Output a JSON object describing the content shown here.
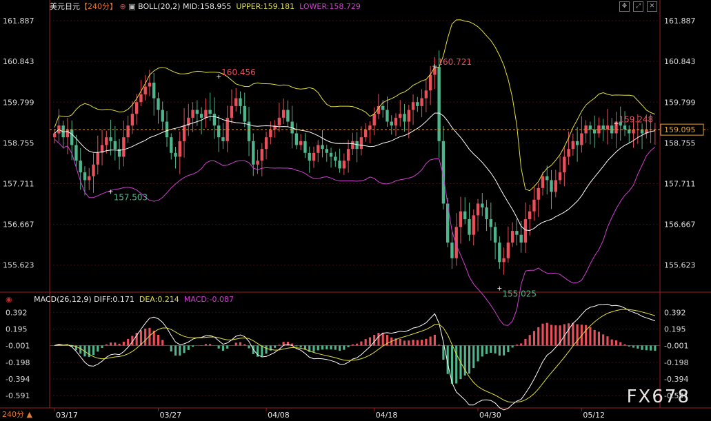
{
  "header": {
    "symbol": "美元日元",
    "period": "【240分】",
    "indicator": "BOLL(20,2)",
    "mid": "MID:158.955",
    "upper": "UPPER:159.181",
    "lower": "LOWER:158.729"
  },
  "macd_header": {
    "indicator": "MACD(26,12,9)",
    "diff": "DIFF:0.171",
    "dea": "DEA:0.214",
    "macd": "MACD:-0.087"
  },
  "footer": {
    "period_button": "240分"
  },
  "watermark": "FX678",
  "colors": {
    "up": "#e8505b",
    "down": "#4fb58c",
    "mid": "#ffffff",
    "upper": "#e3e13c",
    "lower": "#d03fd0",
    "axis": "#9e2020",
    "current": "#e6a93a"
  },
  "chart_data": [
    {
      "type": "line",
      "name": "price",
      "y_ticks": [
        "161.887",
        "160.843",
        "159.799",
        "158.755",
        "157.711",
        "156.667",
        "155.623"
      ],
      "y_range": [
        155.0,
        162.1
      ],
      "x_ticks": [
        "03/17",
        "03/27",
        "04/08",
        "04/18",
        "04/30",
        "05/12"
      ],
      "bars_count": 140,
      "close": [
        159.0,
        159.2,
        158.9,
        159.1,
        158.7,
        158.3,
        158.0,
        157.8,
        157.9,
        158.2,
        158.5,
        158.7,
        158.9,
        158.8,
        158.6,
        158.4,
        158.9,
        159.2,
        159.5,
        159.8,
        160.0,
        160.2,
        160.3,
        159.9,
        159.6,
        159.3,
        158.9,
        158.5,
        158.4,
        158.8,
        159.2,
        159.4,
        159.6,
        159.5,
        159.4,
        159.6,
        159.5,
        159.2,
        158.9,
        158.8,
        159.4,
        159.7,
        159.9,
        159.7,
        159.3,
        158.8,
        158.2,
        158.3,
        158.6,
        158.9,
        159.1,
        159.2,
        159.4,
        159.6,
        159.3,
        159.0,
        158.7,
        158.8,
        158.5,
        158.3,
        158.5,
        158.7,
        158.6,
        158.5,
        158.4,
        158.3,
        158.1,
        158.3,
        158.6,
        158.8,
        158.6,
        158.9,
        159.1,
        159.2,
        159.5,
        159.7,
        159.6,
        159.3,
        159.2,
        159.4,
        159.5,
        159.3,
        159.6,
        159.8,
        159.7,
        159.9,
        160.1,
        160.5,
        160.7,
        158.8,
        157.2,
        156.2,
        155.8,
        156.6,
        157.0,
        156.8,
        156.4,
        156.9,
        157.2,
        157.1,
        156.8,
        156.6,
        156.2,
        155.7,
        155.8,
        156.2,
        156.5,
        156.4,
        156.2,
        156.8,
        157.0,
        157.3,
        157.6,
        157.9,
        157.8,
        157.5,
        157.8,
        158.0,
        158.4,
        158.6,
        158.8,
        158.7,
        159.0,
        159.2,
        159.1,
        159.0,
        159.2,
        159.1,
        159.2,
        159.0,
        159.3,
        159.2,
        159.1,
        159.0,
        159.1,
        159.1,
        159.0,
        159.1,
        159.1,
        159.1
      ],
      "series": [
        {
          "name": "MID",
          "value": 158.955
        },
        {
          "name": "UPPER",
          "value": 159.181
        },
        {
          "name": "LOWER",
          "value": 158.729
        }
      ],
      "current_price": "159.095",
      "annotations": [
        {
          "label": "160.456",
          "index": 38,
          "kind": "high"
        },
        {
          "label": "157.503",
          "index": 13,
          "kind": "low"
        },
        {
          "label": "160.721",
          "index": 88,
          "kind": "high"
        },
        {
          "label": "155.025",
          "index": 103,
          "kind": "low"
        },
        {
          "label": "159.248",
          "index": 130,
          "kind": "high"
        }
      ]
    },
    {
      "type": "bar",
      "name": "MACD",
      "y_ticks": [
        "0.392",
        "0.195",
        "-0.001",
        "-0.198",
        "-0.394",
        "-0.591"
      ],
      "y_range": [
        -0.72,
        0.5
      ],
      "series": [
        {
          "name": "DIFF",
          "value": 0.171
        },
        {
          "name": "DEA",
          "value": 0.214
        },
        {
          "name": "MACD",
          "value": -0.087
        }
      ]
    }
  ]
}
